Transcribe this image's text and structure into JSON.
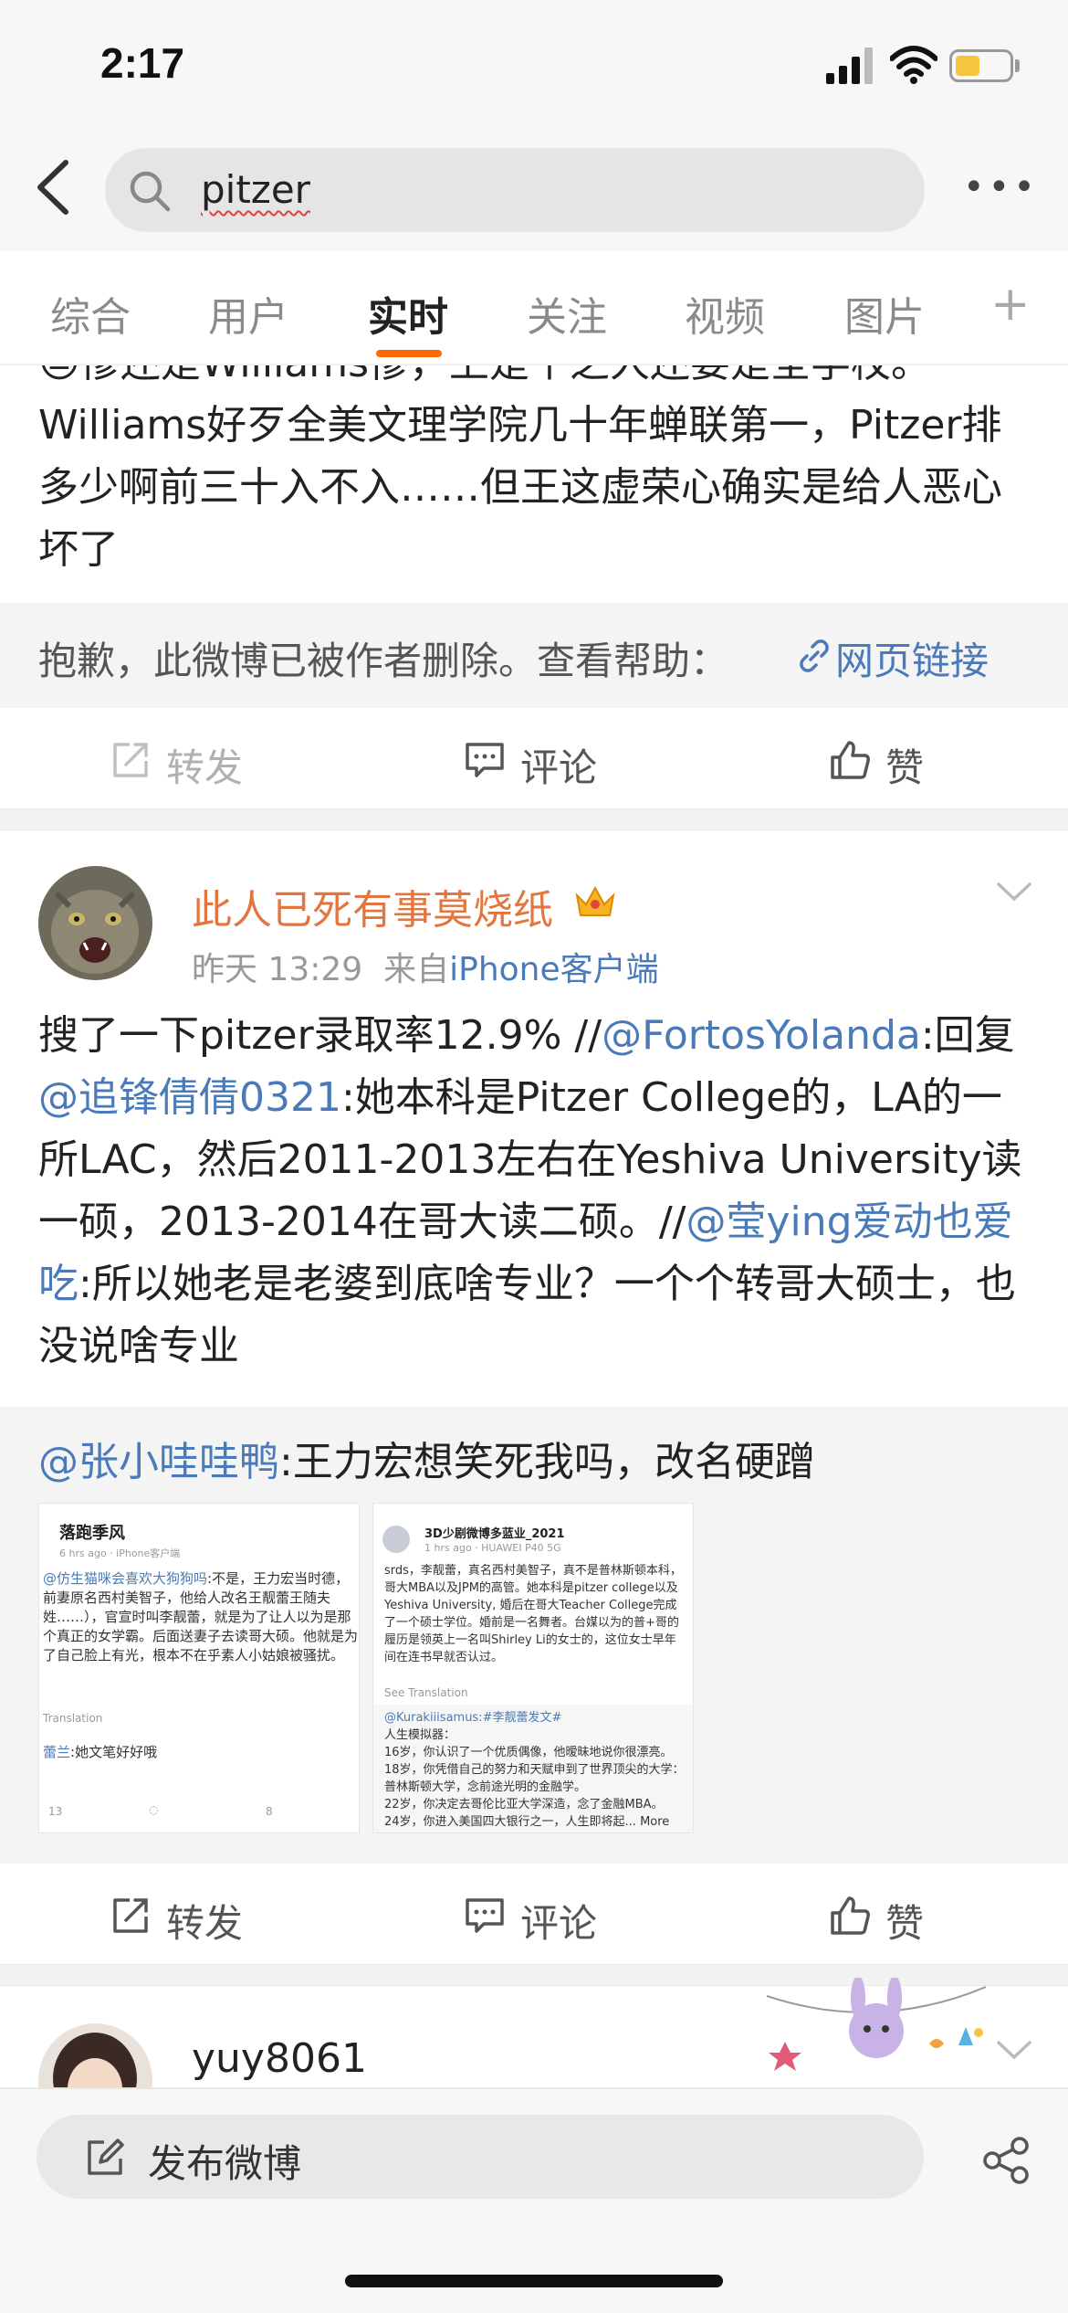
{
  "status": {
    "time": "2:17"
  },
  "search": {
    "query": "pitzer"
  },
  "tabs": [
    {
      "label": "综合"
    },
    {
      "label": "用户"
    },
    {
      "label": "实时"
    },
    {
      "label": "关注"
    },
    {
      "label": "视频"
    },
    {
      "label": "图片"
    }
  ],
  "tabs_plus": "+",
  "post1": {
    "text": "😓惨还是Williams惨，上是个之人还要是全学校。Williams好歹全美文理学院几十年蝉联第一，Pitzer排多少啊前三十入不入……但王这虚荣心确实是给人恶心坏了",
    "deleted_notice": "抱歉，此微博已被作者删除。查看帮助：",
    "help_link": "网页链接"
  },
  "actions1": {
    "repost": "转发",
    "comment": "评论",
    "like": "赞"
  },
  "post2": {
    "username": "此人已死有事莫烧纸",
    "time": "昨天 13:29",
    "from_label": "来自",
    "source": "iPhone客户端",
    "text_parts": {
      "p1": "搜了一下pitzer录取率12.9% //",
      "m1": "@FortosYolanda",
      "p2": ":回复",
      "m2": "@追锋倩倩0321",
      "p3": ":她本科是Pitzer College的，LA的一所LAC，然后2011-2013左右在Yeshiva University读一硕，2013-2014在哥大读二硕。//",
      "m3": "@莹ying爱动也爱吃",
      "p4": ":所以她老是老婆到底啥专业？一个个转哥大硕士，也没说啥专业"
    },
    "repost": {
      "mention": "@张小哇哇鸭",
      "text": ":王力宏想笑死我吗，改名硬蹭"
    },
    "thumb1": {
      "name": "落跑季风",
      "meta": "6 hrs ago · iPhone客户端",
      "mention": "@仿生猫咪会喜欢大狗狗吗",
      "body": ":不是，王力宏当时德，前妻原名西村美智子，他给人改名王靓蕾王随夫姓……），官宣时叫李靓蕾，就是为了让人以为是那个真正的女学霸。后面送妻子去读哥大硕。他就是为了自己脸上有光，根本不在乎素人小姑娘被骚扰。",
      "translation": "Translation",
      "reply_mention": "蕾兰",
      "reply_text": ":她文笔好好哦",
      "count_repost": "13",
      "count_like": "8"
    },
    "thumb2": {
      "name": "3D少剧微博多蓝业_2021",
      "meta": "1 hrs ago · HUAWEI P40 5G",
      "body": "srds，李靓蕾，真名西村美智子，真不是普林斯顿本科，哥大MBA以及JPM的高管。她本科是pitzer college以及Yeshiva University, 婚后在哥大Teacher College完成了一个硕士学位。婚前是一名舞者。台媒以为的普+哥的履历是领英上一名叫Shirley Li的女士的，这位女士早年间在连书早就否认过。",
      "see_translation": "See Translation",
      "mention": "@Kurakiiisamus:#李靓蕾发文#",
      "lines": [
        "人生模拟器：",
        "16岁，你认识了一个优质偶像，他暧昧地说你很漂亮。",
        "18岁，你凭借自己的努力和天赋申到了世界顶尖的大学：普林斯顿大学，念前途光明的金融学。",
        "22岁，你决定去哥伦比亚大学深造，念了金融MBA。",
        "24岁，你进入美国四大银行之一，人生即将起... More"
      ]
    }
  },
  "actions2": {
    "repost": "转发",
    "comment": "评论",
    "like": "赞"
  },
  "post3": {
    "username": "yuy8061"
  },
  "compose": {
    "label": "发布微博"
  },
  "colors": {
    "accent": "#ff6a00",
    "link": "#4a7ab8",
    "username": "#e3763f"
  }
}
